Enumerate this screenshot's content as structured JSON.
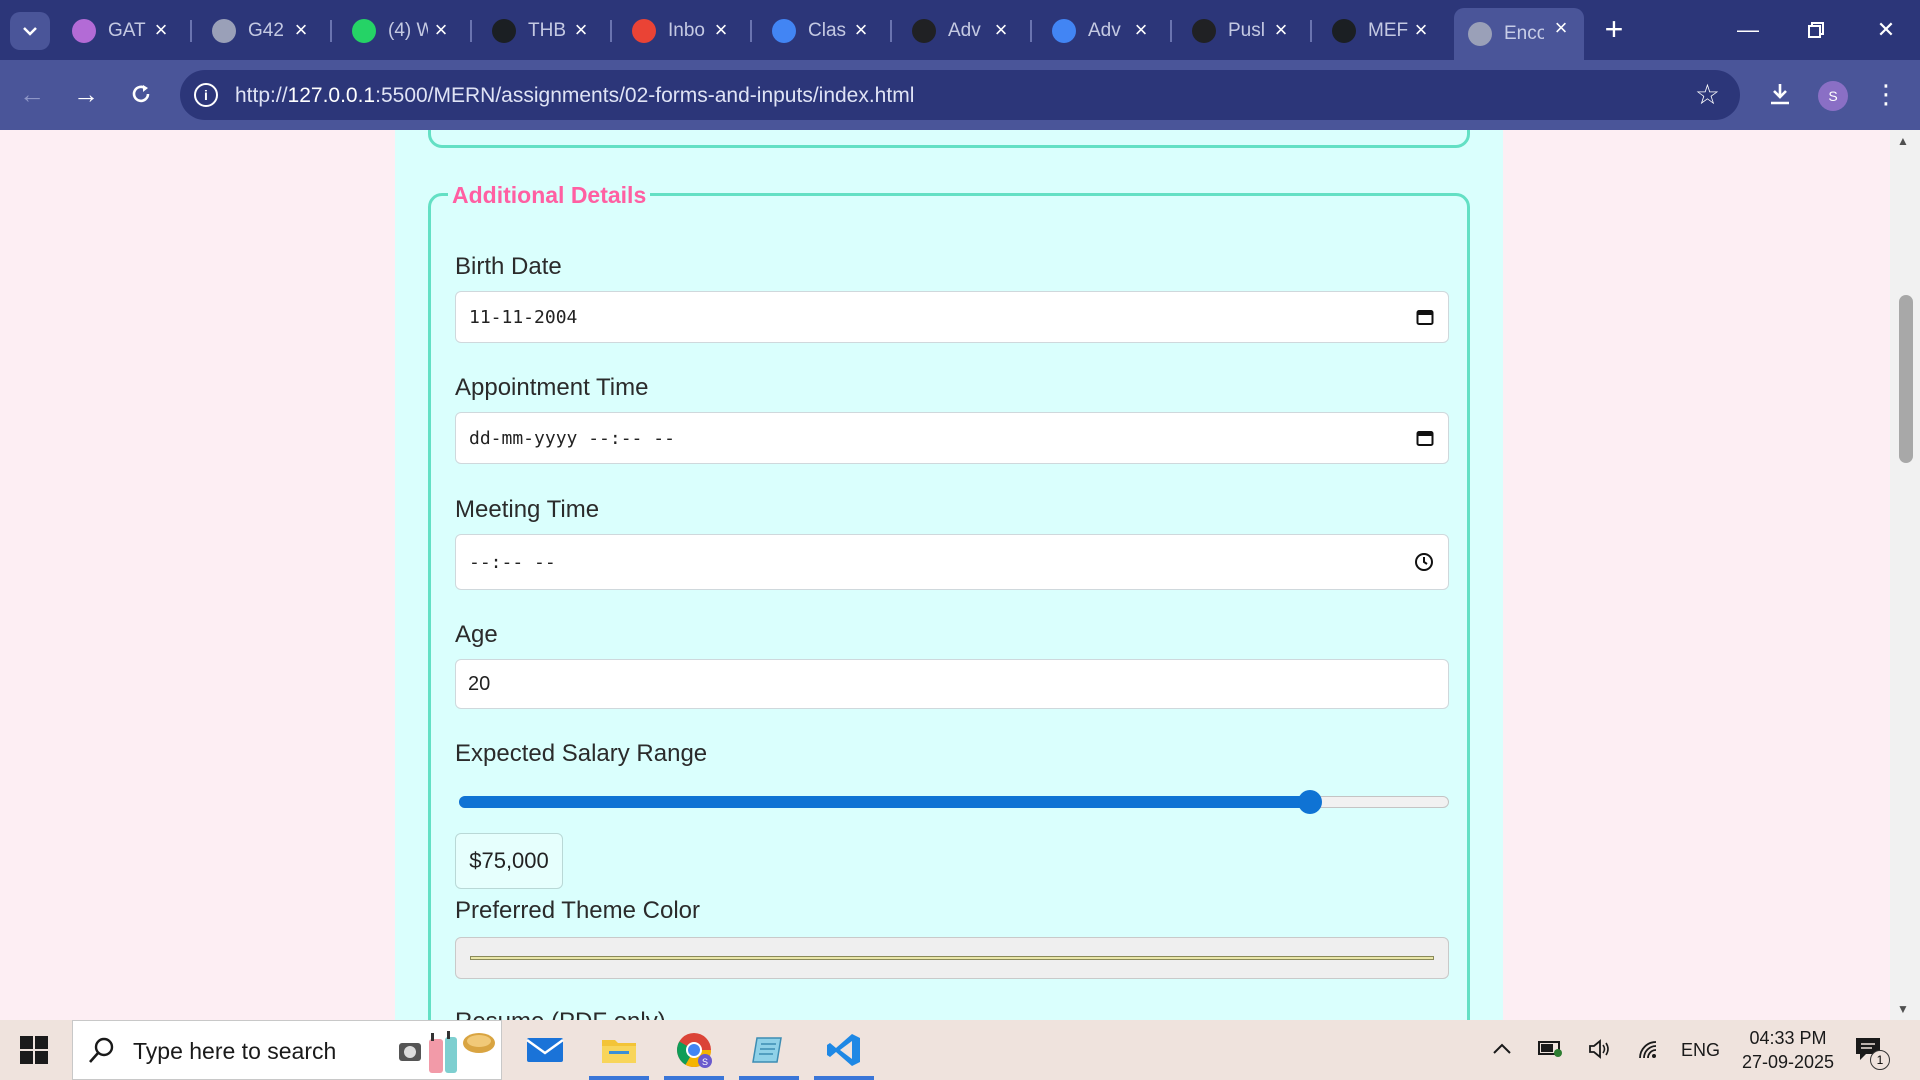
{
  "browser": {
    "tabs": [
      {
        "label": "GAT",
        "favicon": "gat-icon",
        "color": "#b36bd6"
      },
      {
        "label": "G42",
        "favicon": "globe-icon",
        "color": "#9aa0b8"
      },
      {
        "label": "(4) W",
        "favicon": "whatsapp-icon",
        "color": "#25d366"
      },
      {
        "label": "THB",
        "favicon": "github-icon",
        "color": "#1b1f23"
      },
      {
        "label": "Inbo",
        "favicon": "gmail-icon",
        "color": "#ea4335"
      },
      {
        "label": "Clas",
        "favicon": "google-icon",
        "color": "#4285f4"
      },
      {
        "label": "Adv",
        "favicon": "contact-icon",
        "color": "#202124"
      },
      {
        "label": "Adv",
        "favicon": "docs-icon",
        "color": "#4285f4"
      },
      {
        "label": "Pusl",
        "favicon": "openai-icon",
        "color": "#202124"
      },
      {
        "label": "MEF",
        "favicon": "github-icon",
        "color": "#1b1f23"
      },
      {
        "label": "Enco",
        "favicon": "globe-icon",
        "color": "#9aa0b8",
        "active": true
      }
    ],
    "url_scheme": "http://",
    "url_host": "127.0.0.1",
    "url_rest": ":5500/MERN/assignments/02-forms-and-inputs/index.html",
    "profile_initial": "S"
  },
  "form": {
    "legend": "Additional Details",
    "birth_date": {
      "label": "Birth Date",
      "value": "11-11-2004"
    },
    "appointment_time": {
      "label": "Appointment Time",
      "value": "dd-mm-yyyy --:-- --"
    },
    "meeting_time": {
      "label": "Meeting Time",
      "value": "--:-- --"
    },
    "age": {
      "label": "Age",
      "value": "20"
    },
    "salary": {
      "label": "Expected Salary Range",
      "display": "$75,000",
      "fraction": 0.86
    },
    "theme_color": {
      "label": "Preferred Theme Color",
      "value_color": "#e9e6a8"
    },
    "resume": {
      "label": "Resume (PDF only)"
    }
  },
  "taskbar": {
    "search_placeholder": "Type here to search",
    "language": "ENG",
    "time": "04:33 PM",
    "date": "27-09-2025",
    "notification_count": "1"
  },
  "colors": {
    "accent_pink": "#ff5fa2",
    "fieldset_border": "#63e0c4",
    "card_bg": "#dafffd",
    "slider_blue": "#0f73d4"
  }
}
